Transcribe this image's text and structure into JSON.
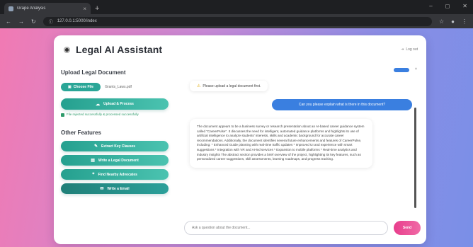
{
  "browser": {
    "tab_title": "Grape Analysis",
    "close_glyph": "×",
    "new_tab_glyph": "+",
    "address": "127.0.0.1:5000/index",
    "window_controls": [
      "–",
      "◻",
      "✕"
    ]
  },
  "app": {
    "title": "Legal AI Assistant",
    "logout_label": "Log out"
  },
  "sidebar": {
    "upload_title": "Upload Legal Document",
    "choose_file_label": "Choose File",
    "no_file_label": "Grants_Laws.pdf",
    "upload_button_label": "Upload & Process",
    "upload_status": "File rejected successfully & processed successfully",
    "other_title": "Other Features",
    "features": [
      {
        "label": "Extract Key Clauses",
        "icon": "pen-icon"
      },
      {
        "label": "Write a Legal Document",
        "icon": "document-icon"
      },
      {
        "label": "Find Nearby Advocates",
        "icon": "location-icon"
      },
      {
        "label": "Write a Email",
        "icon": "mail-icon"
      }
    ]
  },
  "chat": {
    "assistant_prompt": "Please upload a legal document first.",
    "user_question": "Can you please explain what is there in this document?",
    "assistant_response": "The document appears to be a business survey or research presentation about an AI-based career guidance system called \"CareerPulse\". It discusses the need for intelligent, automated guidance platforms and highlights its use of artificial intelligence to analyze students' interests, skills and academic background for accurate career recommendations. Additionally, the document identifies several future enhancements and features of CareerPulse, including: * Enhanced Guide planning with real-time traffic updates * Improved UI and experience with smart suggestions * Integration with VR and AI-led services * Expansion to mobile platforms * Real-time analytics and industry insights The abstract section provides a brief overview of the project, highlighting its key features, such as personalized career suggestions, skill assessments, learning roadmaps, and progress tracking."
  },
  "composer": {
    "placeholder": "Ask a question about the document...",
    "send_label": "Send"
  },
  "colors": {
    "accent_teal": "#2aa697",
    "user_bubble": "#3a7fe0",
    "send_pink": "#e83e8c"
  }
}
